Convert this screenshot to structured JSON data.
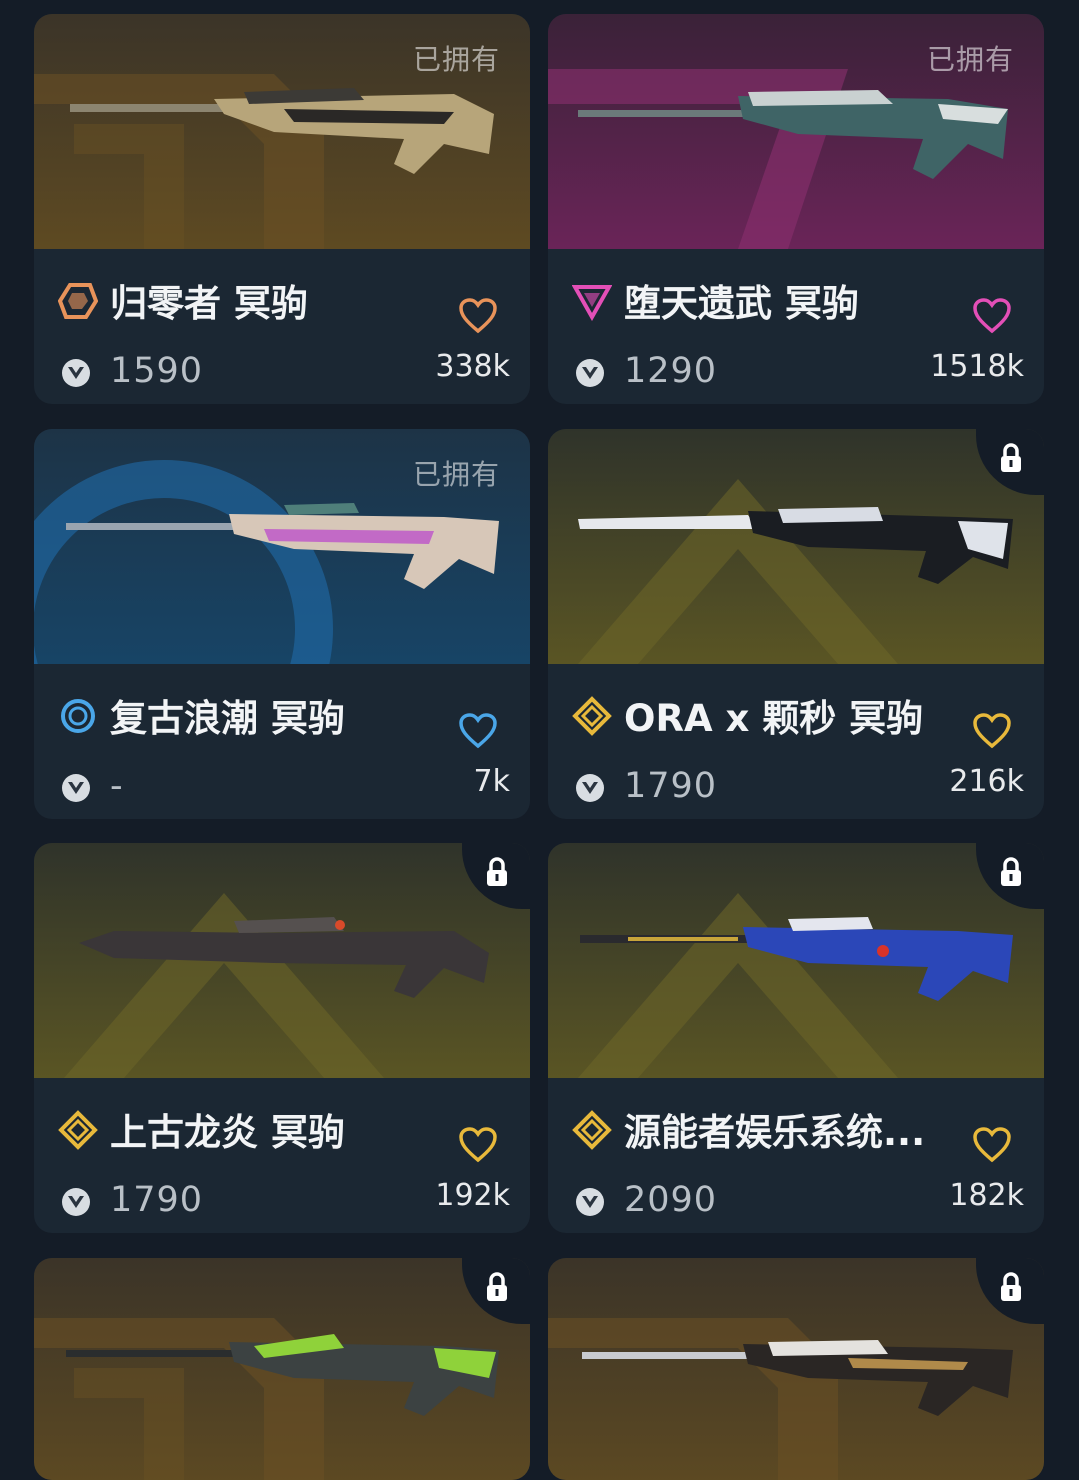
{
  "colors": {
    "page_bg": "#141c27",
    "card_bg": "#1b2733",
    "gold": "#e8b93b",
    "pink": "#e34fb7",
    "blue": "#4aa6e8",
    "bronze": "#e8935a"
  },
  "cards": [
    {
      "name": "归零者 冥驹",
      "owned_label": "已拥有",
      "price": "1590",
      "likes": "338k",
      "tier_icon": "bronze-tier-icon",
      "heart_color": "#e8935a",
      "theme": "bronze"
    },
    {
      "name": "堕天遗武 冥驹",
      "owned_label": "已拥有",
      "price": "1290",
      "likes": "1518k",
      "tier_icon": "pink-tier-icon",
      "heart_color": "#e34fb7",
      "theme": "pink"
    },
    {
      "name": "复古浪潮 冥驹",
      "owned_label": "已拥有",
      "price": "-",
      "likes": "7k",
      "tier_icon": "blue-tier-icon",
      "heart_color": "#4aa6e8",
      "theme": "blue"
    },
    {
      "name": "ORA x 颗秒 冥驹",
      "owned_label": "",
      "price": "1790",
      "likes": "216k",
      "tier_icon": "gold-tier-icon",
      "heart_color": "#e8b93b",
      "theme": "gold",
      "locked": true
    },
    {
      "name": "上古龙炎 冥驹",
      "owned_label": "",
      "price": "1790",
      "likes": "192k",
      "tier_icon": "gold-tier-icon",
      "heart_color": "#e8b93b",
      "theme": "gold",
      "locked": true
    },
    {
      "name": "源能者娱乐系统...",
      "owned_label": "",
      "price": "2090",
      "likes": "182k",
      "tier_icon": "gold-tier-icon",
      "heart_color": "#e8b93b",
      "theme": "gold",
      "locked": true
    },
    {
      "name": "",
      "owned_label": "",
      "price": "",
      "likes": "",
      "tier_icon": "bronze-tier-icon",
      "heart_color": "#e8935a",
      "theme": "bronze",
      "locked": true
    },
    {
      "name": "",
      "owned_label": "",
      "price": "",
      "likes": "",
      "tier_icon": "gold-tier-icon",
      "heart_color": "#e8b93b",
      "theme": "gold",
      "locked": true
    }
  ]
}
